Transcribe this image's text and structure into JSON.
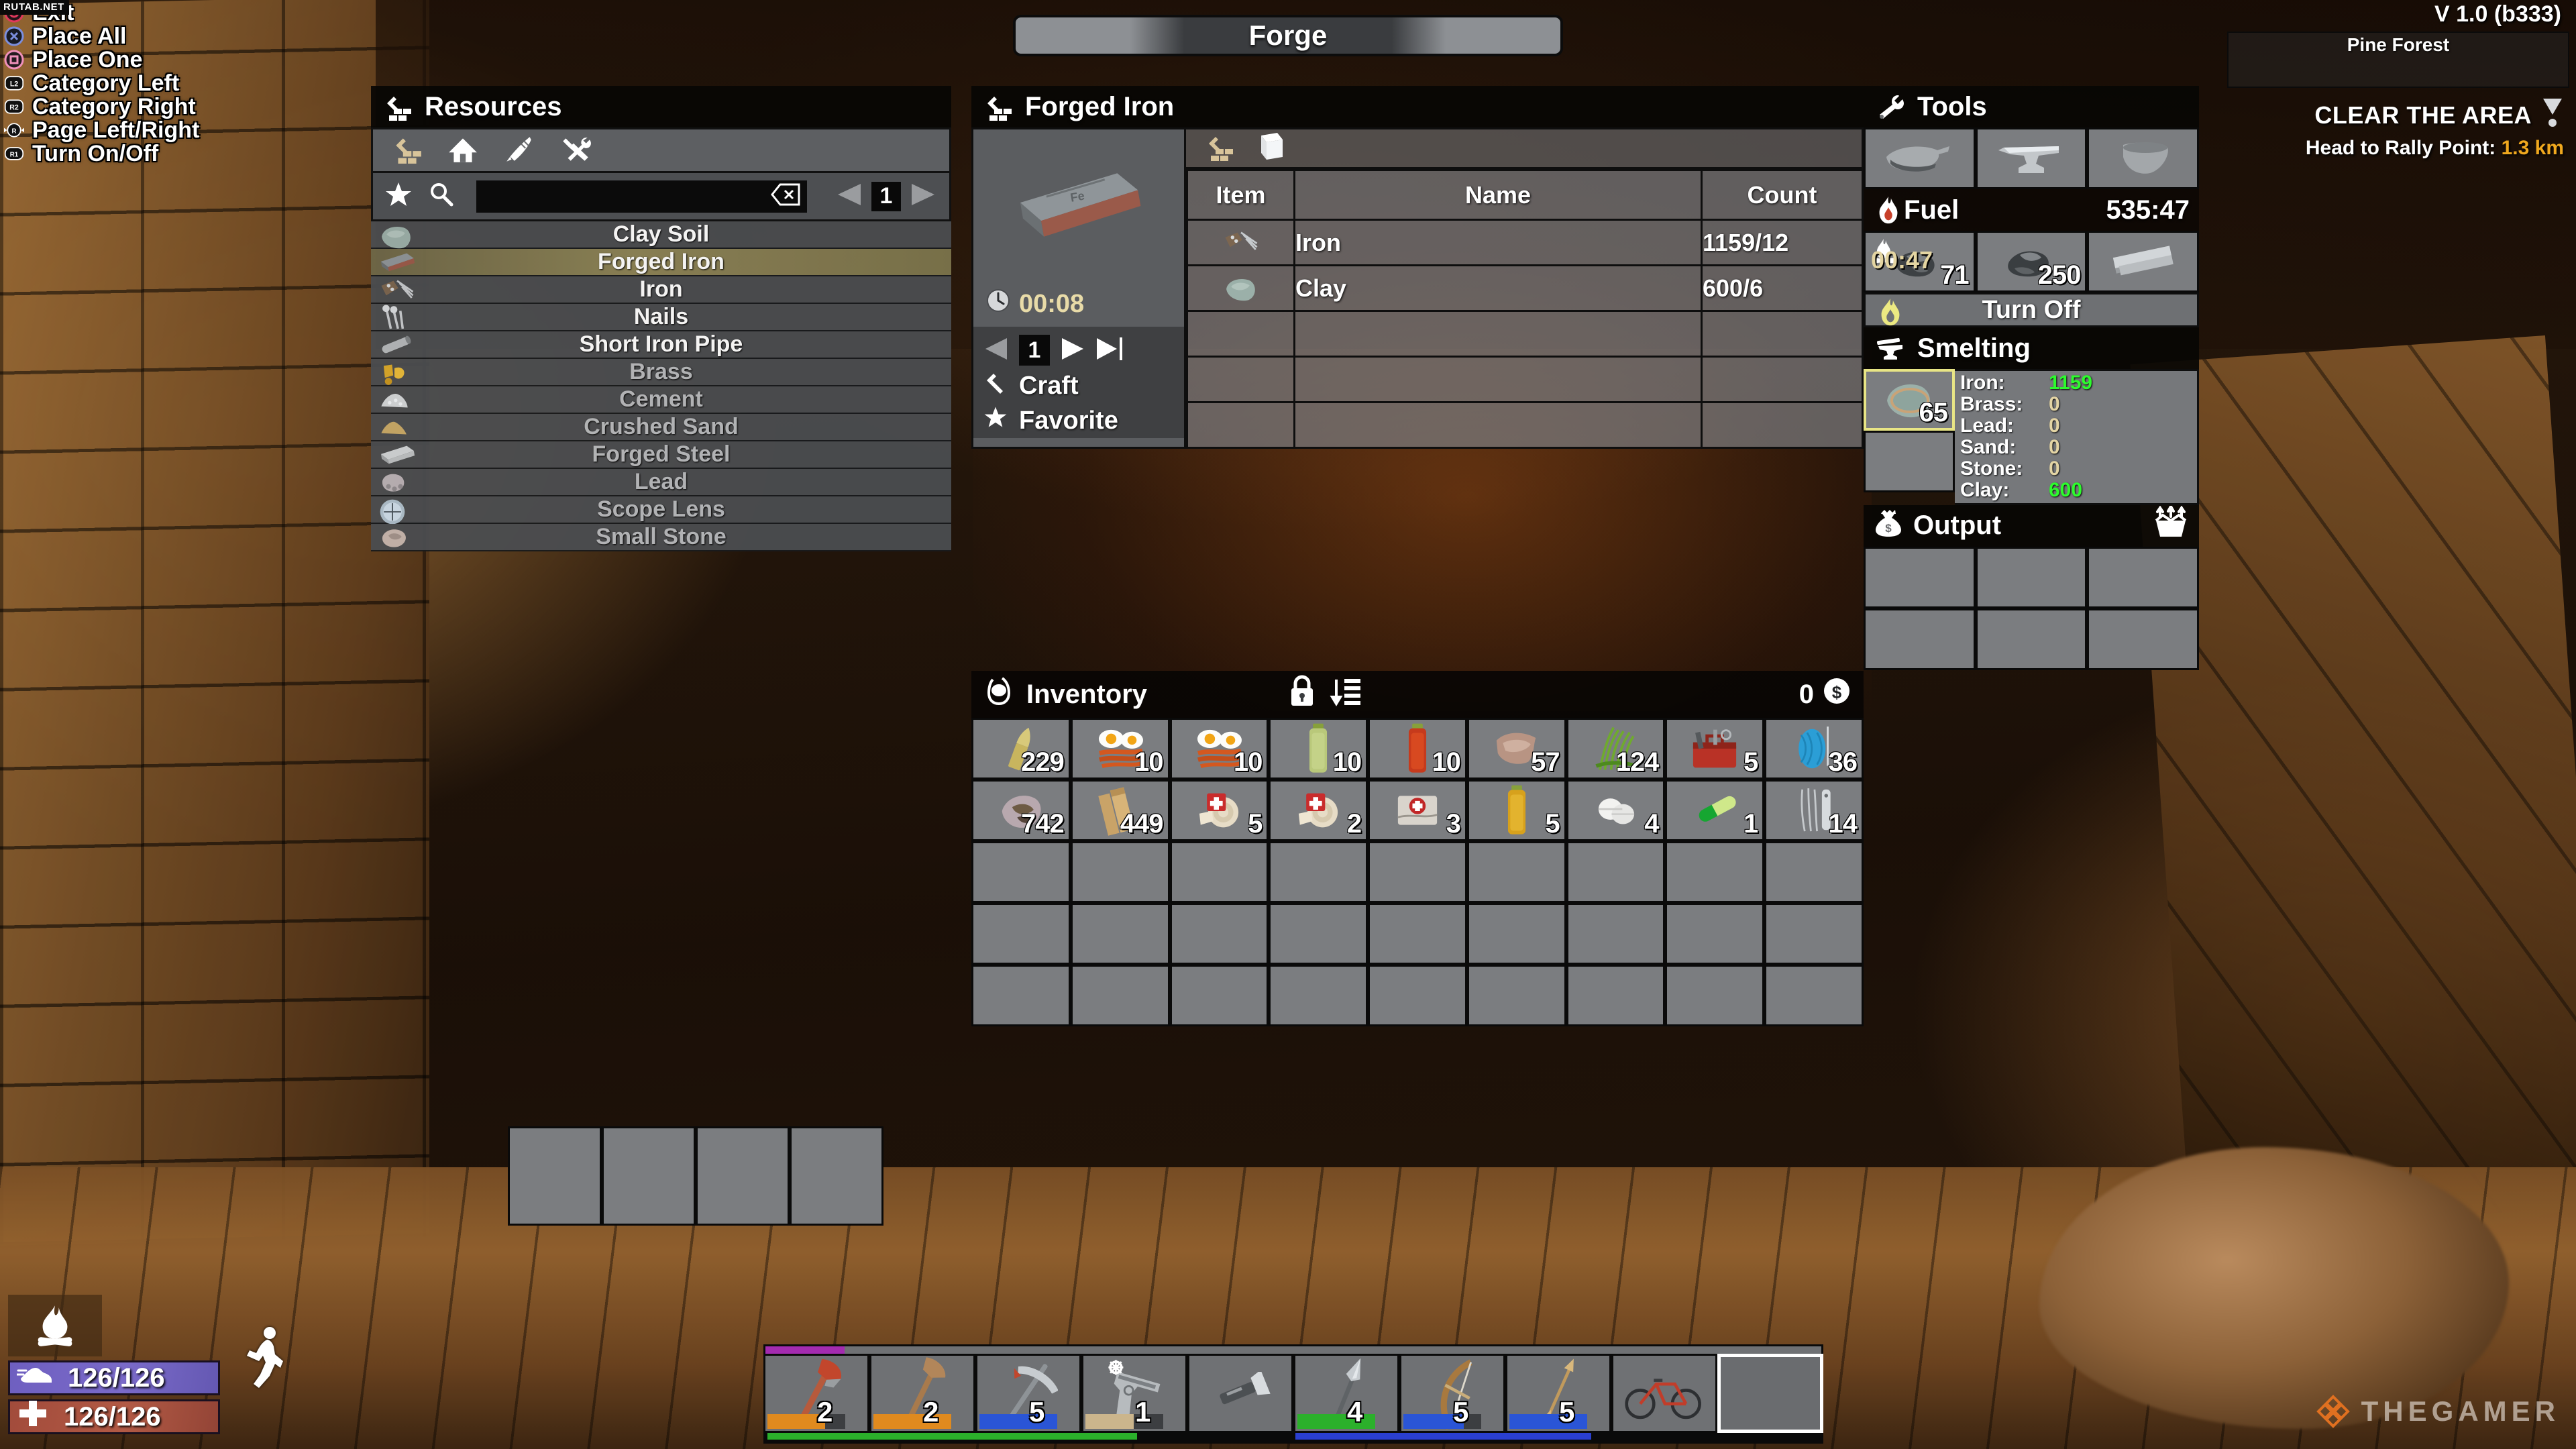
{
  "watermarks": {
    "top_left": "RUTAB.NET",
    "bottom_right": "THEGAMER"
  },
  "window_title": "Forge",
  "hud": {
    "version": "V 1.0 (b333)",
    "biome": "Pine Forest",
    "quest_title": "CLEAR THE AREA",
    "quest_sub_label": "Head to Rally Point:",
    "quest_distance": "1.3 km",
    "stamina": "126/126",
    "health": "126/126",
    "accent_quest": "#f0a81e"
  },
  "controller_hints": [
    {
      "button": "circle",
      "label": "Exit"
    },
    {
      "button": "cross",
      "label": "Place All"
    },
    {
      "button": "square",
      "label": "Place One"
    },
    {
      "button": "L2",
      "label": "Category Left"
    },
    {
      "button": "R2",
      "label": "Category Right"
    },
    {
      "button": "R-stick",
      "label": "Page Left/Right"
    },
    {
      "button": "R1",
      "label": "Turn On/Off"
    }
  ],
  "resources": {
    "title": "Resources",
    "category_icons": [
      "hammer-bricks-icon",
      "house-icon",
      "knife-feather-icon",
      "tools-cross-icon"
    ],
    "search_value": "",
    "page": "1",
    "items": [
      {
        "label": "Clay Soil",
        "icon": "clay-soil-icon",
        "selected": false,
        "dim": false
      },
      {
        "label": "Forged Iron",
        "icon": "forged-iron-icon",
        "selected": true,
        "dim": false
      },
      {
        "label": "Iron",
        "icon": "iron-scrap-icon",
        "selected": false,
        "dim": false
      },
      {
        "label": "Nails",
        "icon": "nails-icon",
        "selected": false,
        "dim": false
      },
      {
        "label": "Short Iron Pipe",
        "icon": "iron-pipe-icon",
        "selected": false,
        "dim": false
      },
      {
        "label": "Brass",
        "icon": "brass-icon",
        "selected": false,
        "dim": true
      },
      {
        "label": "Cement",
        "icon": "cement-icon",
        "selected": false,
        "dim": true
      },
      {
        "label": "Crushed Sand",
        "icon": "crushed-sand-icon",
        "selected": false,
        "dim": true
      },
      {
        "label": "Forged Steel",
        "icon": "forged-steel-icon",
        "selected": false,
        "dim": true
      },
      {
        "label": "Lead",
        "icon": "lead-icon",
        "selected": false,
        "dim": true
      },
      {
        "label": "Scope Lens",
        "icon": "scope-lens-icon",
        "selected": false,
        "dim": true
      },
      {
        "label": "Small Stone",
        "icon": "small-stone-icon",
        "selected": false,
        "dim": true
      }
    ]
  },
  "craft": {
    "title": "Forged Iron",
    "preview_icon": "forged-iron-ingot-icon",
    "craft_time": "00:08",
    "quantity": "1",
    "craft_label": "Craft",
    "favorite_label": "Favorite",
    "tabs": [
      "hammer-bricks-icon",
      "book-icon"
    ],
    "table_headers": {
      "item": "Item",
      "name": "Name",
      "count": "Count"
    },
    "ingredients": [
      {
        "icon": "iron-scrap-icon",
        "name": "Iron",
        "count": "1159/12"
      },
      {
        "icon": "clay-soil-icon",
        "name": "Clay",
        "count": "600/6"
      },
      {
        "icon": "",
        "name": "",
        "count": ""
      },
      {
        "icon": "",
        "name": "",
        "count": ""
      },
      {
        "icon": "",
        "name": "",
        "count": ""
      }
    ]
  },
  "inventory": {
    "title": "Inventory",
    "lock_icon": "lock-icon",
    "sort_icon": "sort-icon",
    "money": "0",
    "money_icon": "dollar-coin-icon",
    "columns": 9,
    "rows": 5,
    "items": [
      {
        "count": "229",
        "icon": "brass-casing-icon",
        "art": "bullet"
      },
      {
        "count": "10",
        "icon": "bacon-eggs-icon",
        "art": "eggs"
      },
      {
        "count": "10",
        "icon": "bacon-eggs-icon",
        "art": "eggs"
      },
      {
        "count": "10",
        "icon": "green-jar-icon",
        "art": "jar-green"
      },
      {
        "count": "10",
        "icon": "red-jar-icon",
        "art": "jar-red"
      },
      {
        "count": "57",
        "icon": "leather-icon",
        "art": "leather"
      },
      {
        "count": "124",
        "icon": "plant-fiber-icon",
        "art": "fiber"
      },
      {
        "count": "5",
        "icon": "toolbox-icon",
        "art": "toolbox"
      },
      {
        "count": "36",
        "icon": "cloth-spool-icon",
        "art": "spool"
      },
      {
        "count": "742",
        "icon": "coal-ore-icon",
        "art": "ore"
      },
      {
        "count": "449",
        "icon": "wood-plank-icon",
        "art": "plank"
      },
      {
        "count": "5",
        "icon": "first-aid-bandage-icon",
        "art": "bandage"
      },
      {
        "count": "2",
        "icon": "first-aid-bandage-icon",
        "art": "bandage"
      },
      {
        "count": "3",
        "icon": "first-aid-kit-icon",
        "art": "aidkit"
      },
      {
        "count": "5",
        "icon": "yellow-jar-icon",
        "art": "jar-yellow"
      },
      {
        "count": "4",
        "icon": "pills-icon",
        "art": "pills"
      },
      {
        "count": "1",
        "icon": "green-capsule-icon",
        "art": "capsule"
      },
      {
        "count": "14",
        "icon": "lockpick-icon",
        "art": "lockpick"
      }
    ]
  },
  "tools": {
    "title": "Tools",
    "icon": "wrench-icon",
    "slots": [
      "bellows-icon",
      "anvil-icon",
      "crucible-icon"
    ]
  },
  "fuel": {
    "title": "Fuel",
    "icon": "flame-icon",
    "total_time": "535:47",
    "slots": [
      {
        "icon": "coal-icon",
        "count": "71",
        "timer": "00:47"
      },
      {
        "icon": "coal-icon",
        "count": "250",
        "timer": ""
      },
      {
        "icon": "wood-plank-icon",
        "count": "",
        "timer": ""
      }
    ],
    "toggle_label": "Turn Off",
    "toggle_icon": "flame-yellow-icon"
  },
  "smelting": {
    "title": "Smelting",
    "icon": "anvil-icon",
    "input_slots": [
      {
        "icon": "clay-soil-icon",
        "count": "65",
        "active": true
      },
      {
        "icon": "",
        "count": "",
        "active": false
      }
    ],
    "stats": [
      {
        "key": "Iron:",
        "value": "1159",
        "highlight": true
      },
      {
        "key": "Brass:",
        "value": "0",
        "highlight": false
      },
      {
        "key": "Lead:",
        "value": "0",
        "highlight": false
      },
      {
        "key": "Sand:",
        "value": "0",
        "highlight": false
      },
      {
        "key": "Stone:",
        "value": "0",
        "highlight": false
      },
      {
        "key": "Clay:",
        "value": "600",
        "highlight": true
      }
    ],
    "color_highlight": "#2dfb2d",
    "color_normal": "#e3d4a4"
  },
  "output": {
    "title": "Output",
    "icon": "money-bag-icon",
    "take-all-icon": "take-all-icon",
    "slots": [
      "",
      "",
      "",
      "",
      "",
      ""
    ]
  },
  "hotbar": {
    "top_bar_fill_pct": 7.5,
    "top_bar_color": "#a42bb0",
    "slots": [
      {
        "icon": "fireaxe-icon",
        "count": "2",
        "durability_pct": 74,
        "durability_color": "#e08a1e",
        "selected": false
      },
      {
        "icon": "stone-axe-icon",
        "count": "2",
        "durability_pct": 100,
        "durability_color": "#e08a1e",
        "selected": false
      },
      {
        "icon": "pickaxe-icon",
        "count": "5",
        "durability_pct": 100,
        "durability_color": "#2a55d6",
        "selected": false
      },
      {
        "icon": "pistol-icon",
        "count": "1",
        "durability_pct": 62,
        "durability_color": "#cbb58c",
        "selected": false
      },
      {
        "icon": "flashlight-icon",
        "count": "",
        "durability_pct": 0,
        "durability_color": "",
        "selected": false
      },
      {
        "icon": "spear-icon",
        "count": "4",
        "durability_pct": 100,
        "durability_color": "#2bb02b",
        "selected": false
      },
      {
        "icon": "bow-icon",
        "count": "5",
        "durability_pct": 78,
        "durability_color": "#2a55d6",
        "selected": false
      },
      {
        "icon": "arrow-icon",
        "count": "5",
        "durability_pct": 100,
        "durability_color": "#2a55d6",
        "selected": false
      },
      {
        "icon": "bicycle-icon",
        "count": "",
        "durability_pct": 0,
        "durability_color": "",
        "selected": false
      },
      {
        "icon": "",
        "count": "",
        "durability_pct": 0,
        "durability_color": "",
        "selected": true
      }
    ],
    "bottom_bars": [
      {
        "color": "#2bb02b",
        "start_pct": 0,
        "width_pct": 35
      },
      {
        "color": "#2a3fd0",
        "start_pct": 50,
        "width_pct": 28
      }
    ]
  }
}
